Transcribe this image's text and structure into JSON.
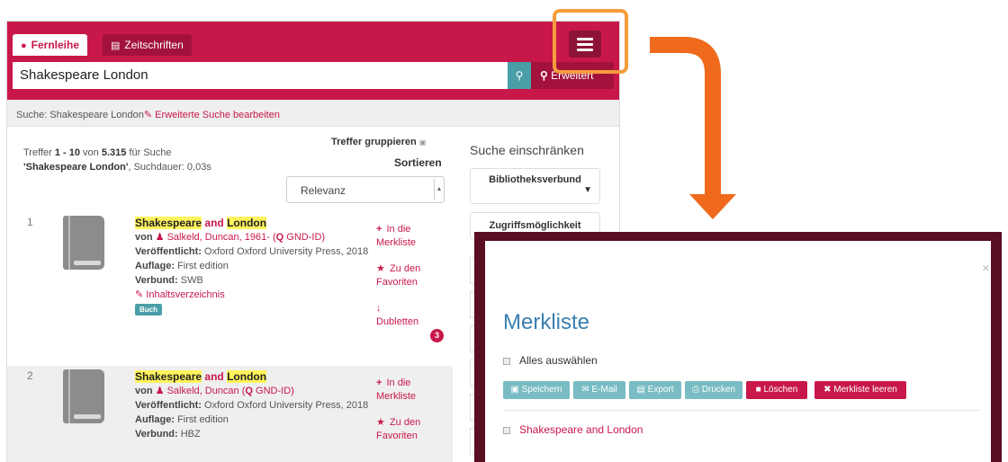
{
  "tabs": [
    {
      "icon": "globe-icon",
      "label": "Fernleihe"
    },
    {
      "icon": "newspaper-icon",
      "label": "Zeitschriften"
    }
  ],
  "search": {
    "value": "Shakespeare London",
    "advanced_label": "Erweitert"
  },
  "breadcrumb": {
    "prefix": "Suche: Shakespeare London",
    "edit_label": "Erweiterte Suche bearbeiten"
  },
  "results_info": {
    "line1_pre": "Treffer ",
    "range_from": "1",
    "range_mid": " - ",
    "range_to": "10",
    "of": " von ",
    "total": "5.315",
    "for_search": " für Suche",
    "query": "'Shakespeare London'",
    "duration": ", Suchdauer: 0,03s"
  },
  "group_label": "Treffer gruppieren",
  "sort": {
    "label": "Sortieren",
    "selected": "Relevanz"
  },
  "results": [
    {
      "number": "1",
      "title_a": "Shakespeare",
      "title_b": " and ",
      "title_c": "London",
      "by": "von ",
      "author": "Salkeld, Duncan, 1961-",
      "gnd": "GND-ID",
      "published_label": "Veröffentlicht:",
      "published": "Oxford Oxford University Press, 2018",
      "edition_label": "Auflage:",
      "edition": "First edition",
      "network_label": "Verbund:",
      "network": "SWB",
      "toc": "Inhaltsverzeichnis",
      "type": "Buch",
      "action_merkliste": "In die Merkliste",
      "action_favoriten": "Zu den Favoriten",
      "action_dubletten": "Dubletten",
      "dubletten_count": "3"
    },
    {
      "number": "2",
      "title_a": "Shakespeare",
      "title_b": " and ",
      "title_c": "London",
      "by": "von ",
      "author": "Salkeld, Duncan",
      "gnd": "GND-ID",
      "published_label": "Veröffentlicht:",
      "published": "Oxford Oxford University Press, 2018",
      "edition_label": "Auflage:",
      "edition": "First edition",
      "network_label": "Verbund:",
      "network": "HBZ",
      "action_merkliste": "In die Merkliste",
      "action_favoriten": "Zu den Favoriten"
    }
  ],
  "facets": {
    "title": "Suche einschränken",
    "items": [
      "Bibliotheksverbund",
      "Zugriffsmöglichkeit"
    ]
  },
  "modal": {
    "close": "×",
    "title": "Merkliste",
    "select_all": "Alles auswählen",
    "buttons": [
      "Speichern",
      "E-Mail",
      "Export",
      "Drucken",
      "Löschen",
      "Merkliste leeren"
    ],
    "items": [
      "Shakespeare and London"
    ]
  },
  "colors": {
    "brand": "#c8184a",
    "teal": "#4a9ea7",
    "highlight": "#f59c3b",
    "arrow": "#ef6a1c"
  }
}
